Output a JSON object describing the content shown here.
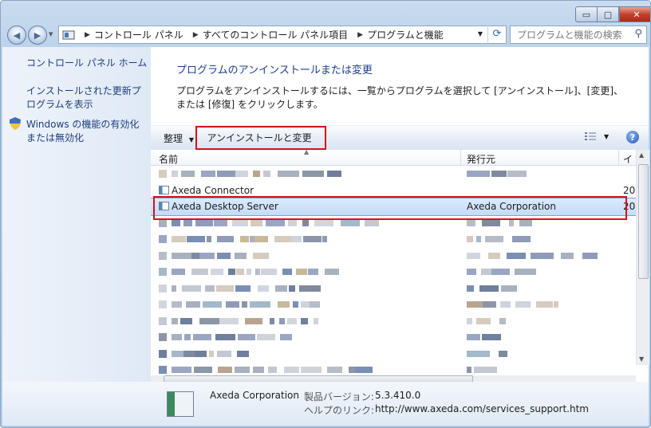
{
  "window": {
    "controls": {
      "minimize": "▭",
      "maximize": "▢",
      "close": "✕"
    }
  },
  "address": {
    "crumbs": [
      "コントロール パネル",
      "すべてのコントロール パネル項目",
      "プログラムと機能"
    ],
    "search_placeholder": "プログラムと機能の検索"
  },
  "sidebar": {
    "home": "コントロール パネル ホーム",
    "updates": "インストールされた更新プログラムを表示",
    "features": "Windows の機能の有効化または無効化"
  },
  "main": {
    "title": "プログラムのアンインストールまたは変更",
    "description": "プログラムをアンインストールするには、一覧からプログラムを選択して [アンインストール]、[変更]、または [修復] をクリックします。"
  },
  "toolbar": {
    "organize": "整理",
    "uninstall_change": "アンインストールと変更"
  },
  "columns": {
    "name": "名前",
    "publisher": "発行元",
    "installed": "イ"
  },
  "rows": [
    {
      "name": "",
      "publisher": "",
      "installed": "",
      "blurred": true
    },
    {
      "name": "Axeda Connector",
      "publisher": "",
      "installed": "20",
      "blurred": false
    },
    {
      "name": "Axeda Desktop Server",
      "publisher": "Axeda Corporation",
      "installed": "20",
      "selected": true
    },
    {
      "name": "",
      "publisher": "",
      "installed": "",
      "blurred": true
    },
    {
      "name": "",
      "publisher": "",
      "installed": "",
      "blurred": true
    },
    {
      "name": "",
      "publisher": "",
      "installed": "",
      "blurred": true
    },
    {
      "name": "",
      "publisher": "",
      "installed": "",
      "blurred": true
    },
    {
      "name": "",
      "publisher": "",
      "installed": "",
      "blurred": true
    },
    {
      "name": "",
      "publisher": "",
      "installed": "",
      "blurred": true
    },
    {
      "name": "",
      "publisher": "",
      "installed": "",
      "blurred": true
    },
    {
      "name": "",
      "publisher": "",
      "installed": "",
      "blurred": true
    },
    {
      "name": "",
      "publisher": "",
      "installed": "",
      "blurred": true
    },
    {
      "name": "",
      "publisher": "",
      "installed": "",
      "blurred": true
    }
  ],
  "details": {
    "publisher": "Axeda Corporation",
    "version_label": "製品バージョン:",
    "version": "5.3.410.0",
    "help_label": "ヘルプのリンク:",
    "help_link": "http://www.axeda.com/services_support.htm"
  },
  "colors": {
    "highlight_box": "#d0141a",
    "link": "#1e3d8c",
    "selection": "#c3dcf7"
  }
}
